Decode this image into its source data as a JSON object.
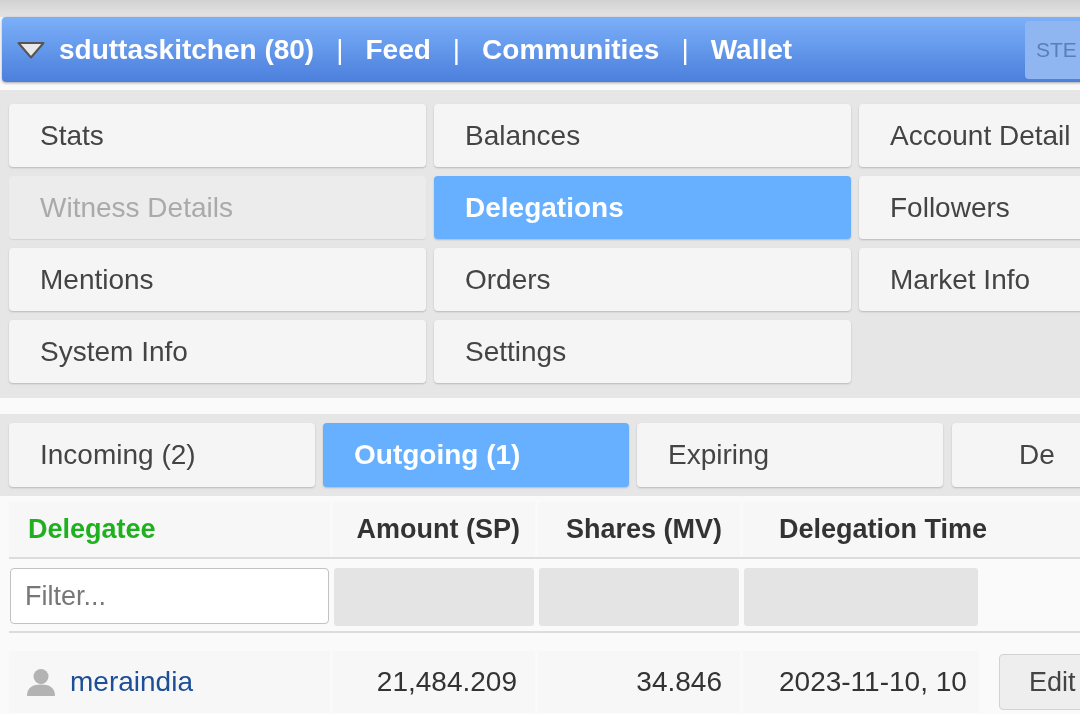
{
  "top_bar": {
    "nav": [
      {
        "kind": "account",
        "label": "sduttaskitchen (80)"
      },
      {
        "kind": "separator",
        "label": "|"
      },
      {
        "kind": "link",
        "label": "Feed"
      },
      {
        "kind": "separator",
        "label": "|"
      },
      {
        "kind": "link",
        "label": "Communities"
      },
      {
        "kind": "separator",
        "label": "|"
      },
      {
        "kind": "link",
        "label": "Wallet"
      }
    ],
    "side_button": {
      "label": "STE"
    }
  },
  "menu": {
    "items": [
      {
        "label": "Stats",
        "selected": false,
        "disabled": false
      },
      {
        "label": "Balances",
        "selected": false,
        "disabled": false
      },
      {
        "label": "Account Detail",
        "selected": false,
        "disabled": false
      },
      {
        "label": "Witness Details",
        "selected": false,
        "disabled": true
      },
      {
        "label": "Delegations",
        "selected": true,
        "disabled": false
      },
      {
        "label": "Followers",
        "selected": false,
        "disabled": false
      },
      {
        "label": "Mentions",
        "selected": false,
        "disabled": false
      },
      {
        "label": "Orders",
        "selected": false,
        "disabled": false
      },
      {
        "label": "Market Info",
        "selected": false,
        "disabled": false
      },
      {
        "label": "System Info",
        "selected": false,
        "disabled": false
      },
      {
        "label": "Settings",
        "selected": false,
        "disabled": false
      }
    ]
  },
  "tabs": [
    {
      "label": "Incoming (2)",
      "selected": false
    },
    {
      "label": "Outgoing (1)",
      "selected": true
    },
    {
      "label": "Expiring",
      "selected": false
    },
    {
      "label": "De",
      "selected": false
    }
  ],
  "table": {
    "columns": [
      {
        "label": "Delegatee",
        "sorted": true
      },
      {
        "label": "Amount (SP)",
        "sorted": false
      },
      {
        "label": "Shares (MV)",
        "sorted": false
      },
      {
        "label": "Delegation Time",
        "sorted": false
      }
    ],
    "filter": {
      "placeholder": "Filter..."
    },
    "rows": [
      {
        "delegatee": "meraindia",
        "amount": "21,484.209",
        "shares": "34.846",
        "time": "2023-11-10, 10",
        "action": "Edit"
      }
    ]
  }
}
